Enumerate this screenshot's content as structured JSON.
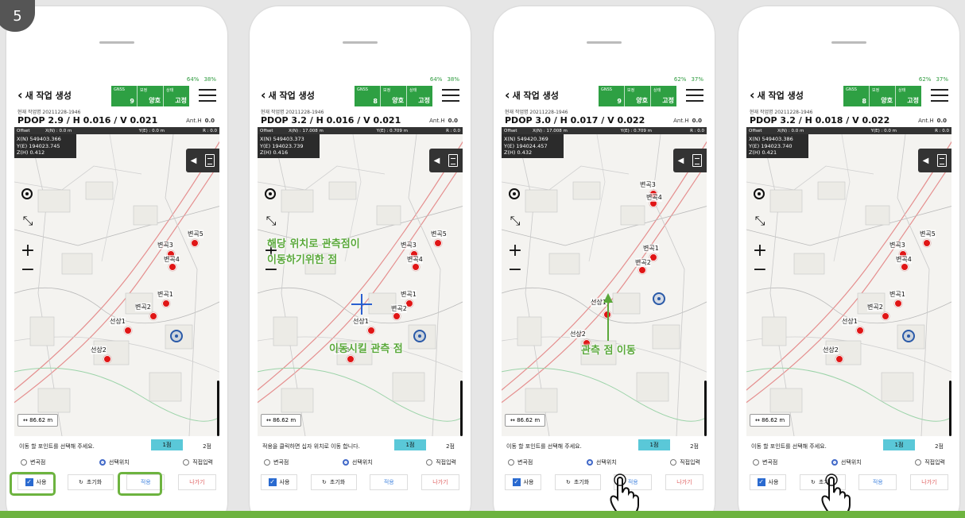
{
  "step_number": "5",
  "phones": [
    {
      "battery_gps": "64%",
      "battery_phone": "38%",
      "title": "새 작업 생성",
      "gnss": {
        "label": "GNSS",
        "value": "9"
      },
      "correction": {
        "label": "보정",
        "value": "양호"
      },
      "state": {
        "label": "상태",
        "value": "고정"
      },
      "job": "현재 작업명 20211228-1946",
      "pdop": "PDOP 2.9 / H 0.016 / V 0.021",
      "anth_label": "Ant.H",
      "anth_value": "0.0",
      "offset": {
        "label": "Offset",
        "xn": "X(N) : 0.0 m",
        "ye": "Y(E) : 0.0 m",
        "r": "R : 0.0"
      },
      "coords": {
        "x": "X(N) 549403.366",
        "y": "Y(E) 194023.745",
        "z": "Z(H) 0.412"
      },
      "points": [
        "변곡3",
        "변곡5",
        "변곡4",
        "변곡1",
        "변곡2",
        "선상1",
        "선상2"
      ],
      "scale": "86.62 m",
      "instruction": "이동 할 포인트를 선택해 주세요.",
      "tab1": "1점",
      "tab2": "2점",
      "radios": [
        "변곡점",
        "선택위치",
        "직접입력"
      ],
      "buttons": {
        "use": "사용",
        "reset": "초기화",
        "apply": "적용",
        "exit": "나가기"
      }
    },
    {
      "battery_gps": "64%",
      "battery_phone": "38%",
      "title": "새 작업 생성",
      "gnss": {
        "label": "GNSS",
        "value": "8"
      },
      "correction": {
        "label": "보정",
        "value": "양호"
      },
      "state": {
        "label": "상태",
        "value": "고정"
      },
      "job": "현재 작업명 20211228-1946",
      "pdop": "PDOP 3.2 / H 0.016 / V 0.021",
      "anth_label": "Ant.H",
      "anth_value": "0.0",
      "offset": {
        "label": "Offset",
        "xn": "X(N) : 17.008 m",
        "ye": "Y(E) : 0.709 m",
        "r": "R : 0.0"
      },
      "coords": {
        "x": "X(N) 549403.373",
        "y": "Y(E) 194023.739",
        "z": "Z(H) 0.416"
      },
      "points": [
        "변곡3",
        "변곡5",
        "변곡4",
        "변곡1",
        "변곡2",
        "선상1",
        "선상2"
      ],
      "scale": "86.62 m",
      "instruction": "적용을 클릭하면 십자 위치로 이동 합니다.",
      "tab1": "1점",
      "tab2": "2점",
      "radios": [
        "변곡점",
        "선택위치",
        "직접입력"
      ],
      "buttons": {
        "use": "사용",
        "reset": "초기화",
        "apply": "적용",
        "exit": "나가기"
      },
      "annotation_top": "해당 위치로 관측점이\n이동하기위한 점",
      "annotation_bottom": "이동시킬 관측 점"
    },
    {
      "battery_gps": "62%",
      "battery_phone": "37%",
      "title": "새 작업 생성",
      "gnss": {
        "label": "GNSS",
        "value": "9"
      },
      "correction": {
        "label": "보정",
        "value": "양호"
      },
      "state": {
        "label": "상태",
        "value": "고정"
      },
      "job": "현재 작업명 20211228-1946",
      "pdop": "PDOP 3.0 / H 0.017 / V 0.022",
      "anth_label": "Ant.H",
      "anth_value": "0.0",
      "offset": {
        "label": "Offset",
        "xn": "X(N) : 17.008 m",
        "ye": "Y(E) : 0.709 m",
        "r": "R : 0.0"
      },
      "coords": {
        "x": "X(N) 549420.369",
        "y": "Y(E) 194024.457",
        "z": "Z(H) 0.432"
      },
      "points": [
        "변곡3",
        "변곡4",
        "변곡1",
        "변곡2",
        "선상1",
        "선상2"
      ],
      "scale": "86.62 m",
      "instruction": "이동 할 포인트를 선택해 주세요.",
      "tab1": "1점",
      "tab2": "2점",
      "radios": [
        "변곡점",
        "선택위치",
        "직접입력"
      ],
      "buttons": {
        "use": "사용",
        "reset": "초기화",
        "apply": "적용",
        "exit": "나가기"
      },
      "annotation_bottom": "관측 점 이동"
    },
    {
      "battery_gps": "62%",
      "battery_phone": "37%",
      "title": "새 작업 생성",
      "gnss": {
        "label": "GNSS",
        "value": "8"
      },
      "correction": {
        "label": "보정",
        "value": "양호"
      },
      "state": {
        "label": "상태",
        "value": "고정"
      },
      "job": "현재 작업명 20211228-1946",
      "pdop": "PDOP 3.2 / H 0.018 / V 0.022",
      "anth_label": "Ant.H",
      "anth_value": "0.0",
      "offset": {
        "label": "Offset",
        "xn": "X(N) : 0.0 m",
        "ye": "Y(E) : 0.0 m",
        "r": "R : 0.0"
      },
      "coords": {
        "x": "X(N) 549403.386",
        "y": "Y(E) 194023.740",
        "z": "Z(H) 0.421"
      },
      "points": [
        "변곡3",
        "변곡5",
        "변곡4",
        "변곡1",
        "변곡2",
        "선상1",
        "선상2"
      ],
      "scale": "86.62 m",
      "instruction": "이동 할 포인트를 선택해 주세요.",
      "tab1": "1점",
      "tab2": "2점",
      "radios": [
        "변곡점",
        "선택위치",
        "직접입력"
      ],
      "buttons": {
        "use": "사용",
        "reset": "초기화",
        "apply": "적용",
        "exit": "나가기"
      }
    }
  ],
  "colors": {
    "accent_green": "#6db33f",
    "gnss_green": "#2ea043",
    "point_red": "#e01515",
    "cross_blue": "#2a5fd0"
  }
}
